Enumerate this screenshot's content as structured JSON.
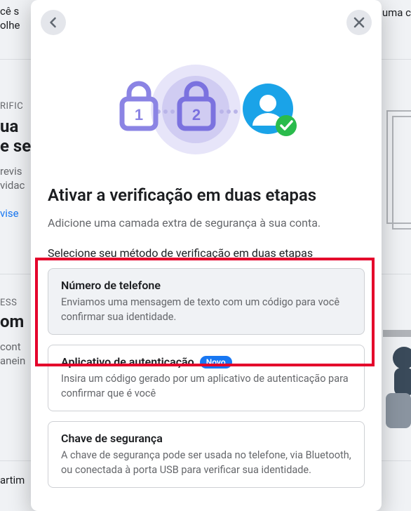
{
  "bg": {
    "t1": "cê s",
    "t2": "olhe",
    "label1": "RIFIC",
    "title1": "ua",
    "title2": "e se",
    "p1": "revis",
    "p2": "vidac",
    "link1": "vise",
    "label2": "ESS",
    "title3": "om",
    "p3": "cont",
    "p4": "anein",
    "p5": "artim",
    "r1": "uma c"
  },
  "modal": {
    "title": "Ativar a verificação em duas etapas",
    "subtitle": "Adicione uma camada extra de segurança à sua conta.",
    "section_label": "Selecione seu método de verificação em duas etapas",
    "options": [
      {
        "title": "Número de telefone",
        "desc": "Enviamos uma mensagem de texto com um código para você confirmar sua identidade.",
        "badge": ""
      },
      {
        "title": "Aplicativo de autenticação",
        "desc": "Insira um código gerado por um aplicativo de autenticação para confirmar que é você",
        "badge": "Novo"
      },
      {
        "title": "Chave de segurança",
        "desc": "A chave de segurança pode ser usada no telefone, via Bluetooth, ou conectada à porta USB para verificar sua identidade.",
        "badge": ""
      }
    ]
  }
}
